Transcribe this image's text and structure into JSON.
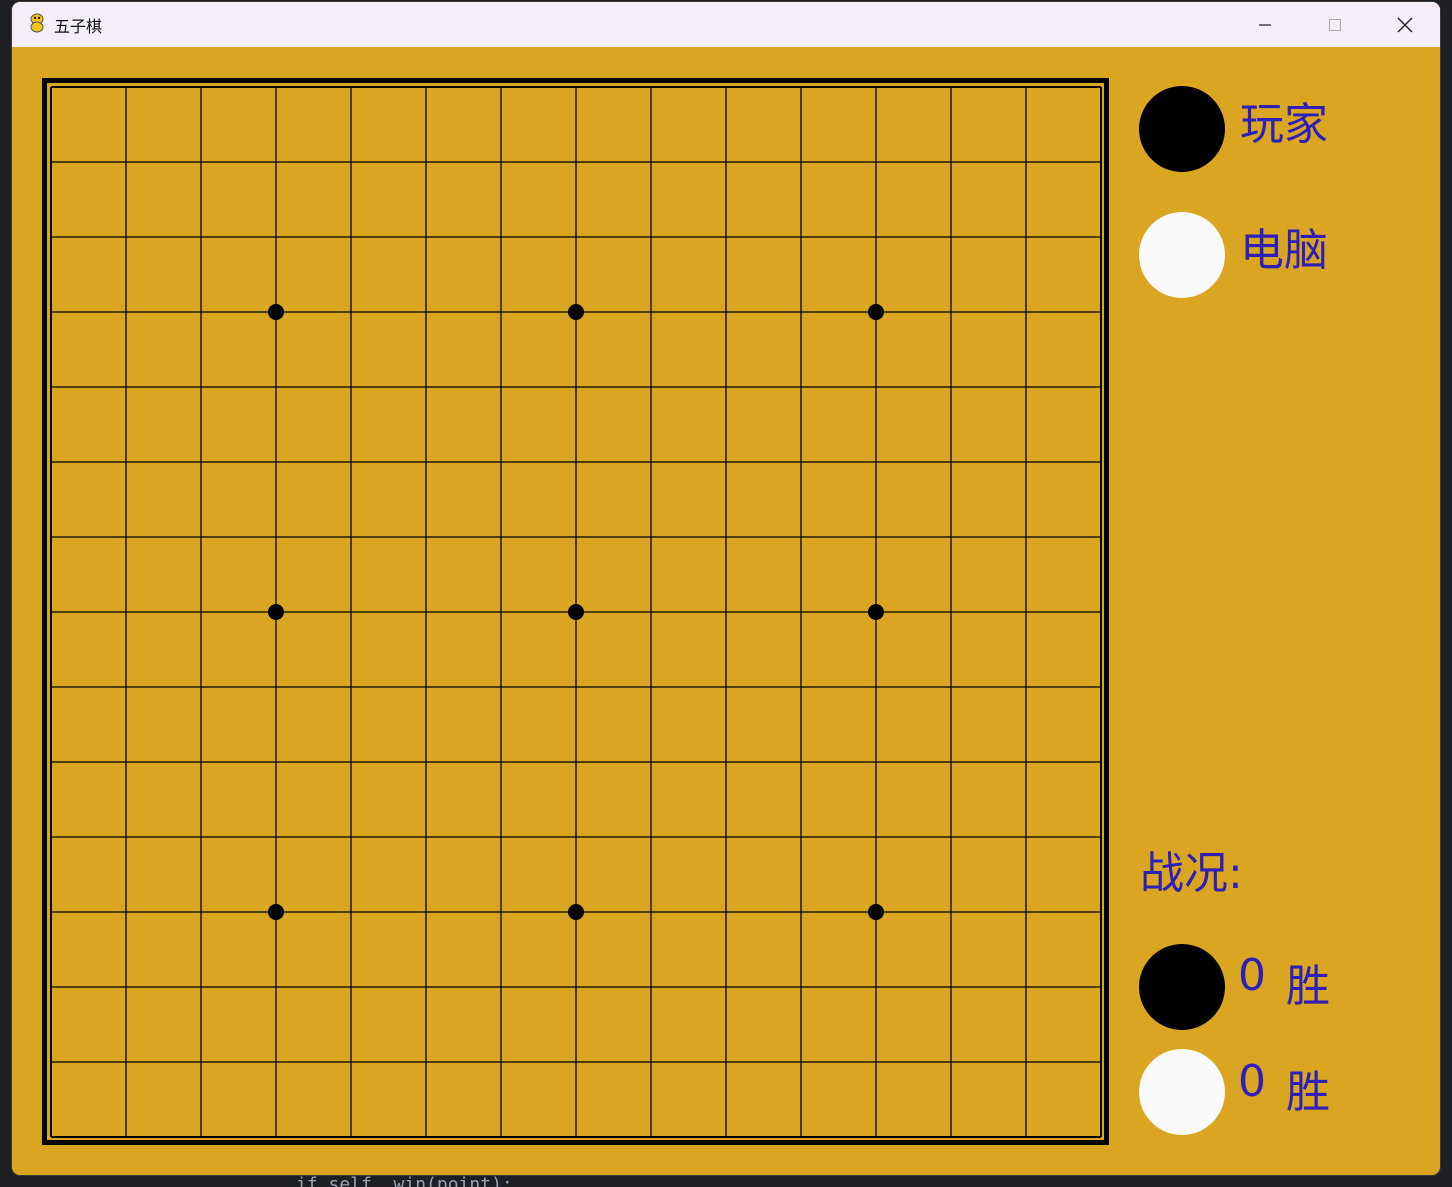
{
  "window": {
    "title": "五子棋",
    "controls": [
      "minimize-icon",
      "maximize-icon",
      "close-icon"
    ]
  },
  "colors": {
    "board_background": "#daa520",
    "label_text": "#2d1fb8",
    "black_stone": "#000000",
    "white_stone": "#fafafa"
  },
  "board": {
    "grid_cells": 14,
    "star_points": [
      [
        3,
        3
      ],
      [
        7,
        3
      ],
      [
        11,
        3
      ],
      [
        3,
        7
      ],
      [
        7,
        7
      ],
      [
        11,
        7
      ],
      [
        3,
        11
      ],
      [
        7,
        11
      ],
      [
        11,
        11
      ]
    ]
  },
  "side_panel": {
    "player_label": "玩家",
    "player_stone": "black",
    "computer_label": "电脑",
    "computer_stone": "white",
    "record_label": "战况:",
    "black_wins": "0",
    "white_wins": "0",
    "wins_suffix": "胜"
  },
  "background_editor": {
    "code_fragment": "if self._win(point):"
  }
}
